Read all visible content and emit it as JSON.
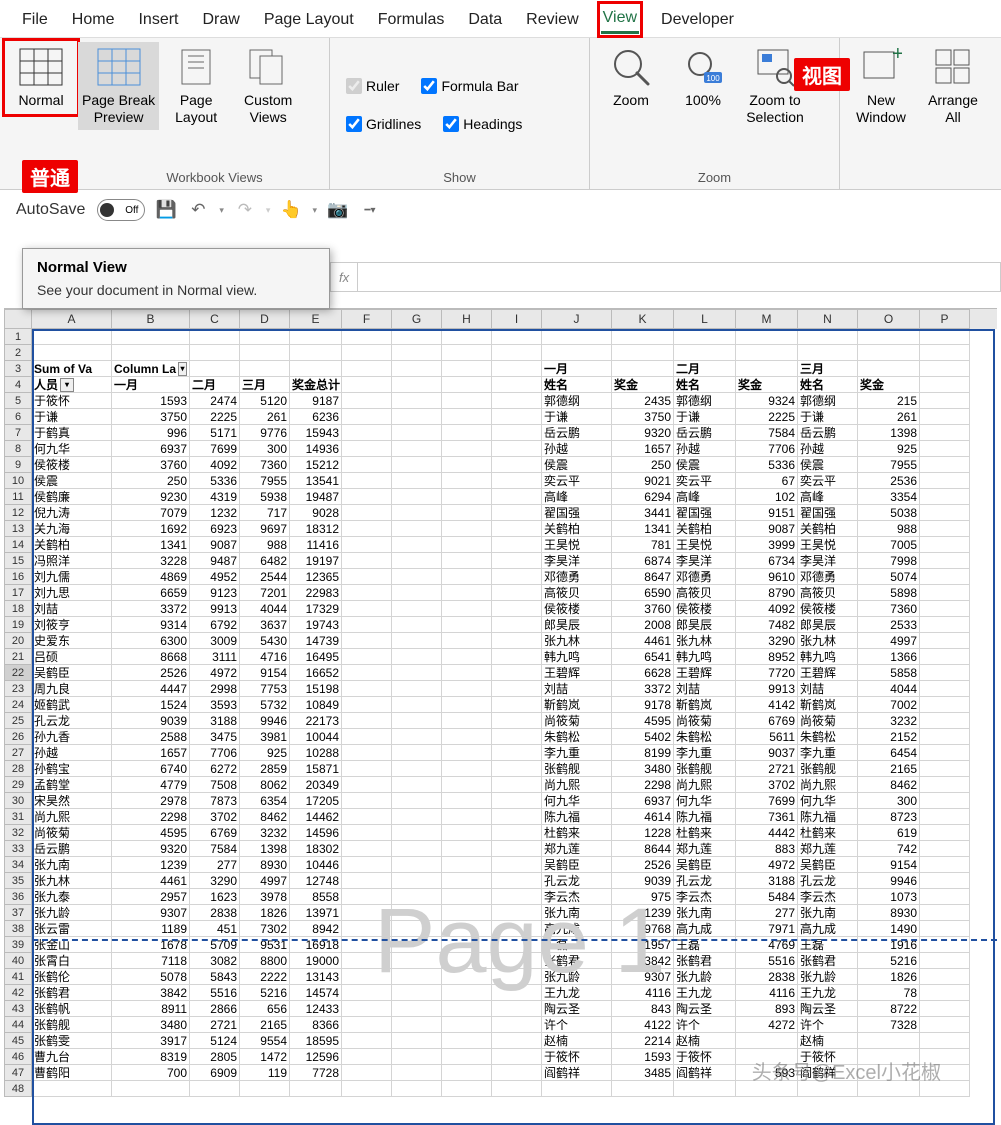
{
  "tabs": [
    "File",
    "Home",
    "Insert",
    "Draw",
    "Page Layout",
    "Formulas",
    "Data",
    "Review",
    "View",
    "Developer"
  ],
  "active_tab": "View",
  "ribbon": {
    "workbook_views": {
      "label": "Workbook Views",
      "buttons": [
        "Normal",
        "Page Break\nPreview",
        "Page\nLayout",
        "Custom\nViews"
      ]
    },
    "show": {
      "label": "Show",
      "checks": [
        {
          "label": "Ruler",
          "checked": true,
          "disabled": true
        },
        {
          "label": "Formula Bar",
          "checked": true
        },
        {
          "label": "Gridlines",
          "checked": true
        },
        {
          "label": "Headings",
          "checked": true
        }
      ]
    },
    "zoom": {
      "label": "Zoom",
      "buttons": [
        "Zoom",
        "100%",
        "Zoom to\nSelection"
      ]
    },
    "window": {
      "buttons": [
        "New\nWindow",
        "Arrange\nAll"
      ]
    }
  },
  "qat": {
    "autosave": "AutoSave",
    "autosave_state": "Off"
  },
  "tooltip": {
    "title": "Normal View",
    "body": "See your document in Normal view."
  },
  "annotations": {
    "normal_cn": "普通",
    "view_cn": "视图"
  },
  "watermark": "Page 1",
  "author_watermark": "头条号@Excel小花椒",
  "cols": {
    "A": 80,
    "B": 78,
    "C": 50,
    "D": 50,
    "E": 52,
    "F": 50,
    "G": 50,
    "H": 50,
    "I": 50,
    "J": 70,
    "K": 62,
    "L": 62,
    "M": 62,
    "N": 60,
    "O": 62,
    "P": 50
  },
  "row3": {
    "A": "Sum of Va",
    "B": "Column La",
    "J": "一月",
    "L": "二月",
    "N": "三月"
  },
  "row4": {
    "A": "人员",
    "B": "一月",
    "C": "二月",
    "D": "三月",
    "E": "奖金总计",
    "J": "姓名",
    "K": "奖金",
    "L": "姓名",
    "M": "奖金",
    "N": "姓名",
    "O": "奖金"
  },
  "data": [
    {
      "n": 5,
      "A": "于筱怀",
      "B": 1593,
      "C": 2474,
      "D": 5120,
      "E": 9187,
      "J": "郭德纲",
      "K": 2435,
      "L": "郭德纲",
      "M": 9324,
      "N": "郭德纲",
      "O": 215
    },
    {
      "n": 6,
      "A": "于谦",
      "B": 3750,
      "C": 2225,
      "D": 261,
      "E": 6236,
      "J": "于谦",
      "K": 3750,
      "L": "于谦",
      "M": 2225,
      "N": "于谦",
      "O": 261
    },
    {
      "n": 7,
      "A": "于鹤真",
      "B": 996,
      "C": 5171,
      "D": 9776,
      "E": 15943,
      "J": "岳云鹏",
      "K": 9320,
      "L": "岳云鹏",
      "M": 7584,
      "N": "岳云鹏",
      "O": 1398
    },
    {
      "n": 8,
      "A": "何九华",
      "B": 6937,
      "C": 7699,
      "D": 300,
      "E": 14936,
      "J": "孙越",
      "K": 1657,
      "L": "孙越",
      "M": 7706,
      "N": "孙越",
      "O": 925
    },
    {
      "n": 9,
      "A": "侯筱楼",
      "B": 3760,
      "C": 4092,
      "D": 7360,
      "E": 15212,
      "J": "侯震",
      "K": 250,
      "L": "侯震",
      "M": 5336,
      "N": "侯震",
      "O": 7955
    },
    {
      "n": 10,
      "A": "侯震",
      "B": 250,
      "C": 5336,
      "D": 7955,
      "E": 13541,
      "J": "奕云平",
      "K": 9021,
      "L": "奕云平",
      "M": 67,
      "N": "奕云平",
      "O": 2536
    },
    {
      "n": 11,
      "A": "侯鹤廉",
      "B": 9230,
      "C": 4319,
      "D": 5938,
      "E": 19487,
      "J": "高峰",
      "K": 6294,
      "L": "高峰",
      "M": 102,
      "N": "高峰",
      "O": 3354
    },
    {
      "n": 12,
      "A": "倪九涛",
      "B": 7079,
      "C": 1232,
      "D": 717,
      "E": 9028,
      "J": "翟国强",
      "K": 3441,
      "L": "翟国强",
      "M": 9151,
      "N": "翟国强",
      "O": 5038
    },
    {
      "n": 13,
      "A": "关九海",
      "B": 1692,
      "C": 6923,
      "D": 9697,
      "E": 18312,
      "J": "关鹤柏",
      "K": 1341,
      "L": "关鹤柏",
      "M": 9087,
      "N": "关鹤柏",
      "O": 988
    },
    {
      "n": 14,
      "A": "关鹤柏",
      "B": 1341,
      "C": 9087,
      "D": 988,
      "E": 11416,
      "J": "王昊悦",
      "K": 781,
      "L": "王昊悦",
      "M": 3999,
      "N": "王昊悦",
      "O": 7005
    },
    {
      "n": 15,
      "A": "冯照洋",
      "B": 3228,
      "C": 9487,
      "D": 6482,
      "E": 19197,
      "J": "李昊洋",
      "K": 6874,
      "L": "李昊洋",
      "M": 6734,
      "N": "李昊洋",
      "O": 7998
    },
    {
      "n": 16,
      "A": "刘九儒",
      "B": 4869,
      "C": 4952,
      "D": 2544,
      "E": 12365,
      "J": "邓德勇",
      "K": 8647,
      "L": "邓德勇",
      "M": 9610,
      "N": "邓德勇",
      "O": 5074
    },
    {
      "n": 17,
      "A": "刘九思",
      "B": 6659,
      "C": 9123,
      "D": 7201,
      "E": 22983,
      "J": "高筱贝",
      "K": 6590,
      "L": "高筱贝",
      "M": 8790,
      "N": "高筱贝",
      "O": 5898
    },
    {
      "n": 18,
      "A": "刘喆",
      "B": 3372,
      "C": 9913,
      "D": 4044,
      "E": 17329,
      "J": "侯筱楼",
      "K": 3760,
      "L": "侯筱楼",
      "M": 4092,
      "N": "侯筱楼",
      "O": 7360
    },
    {
      "n": 19,
      "A": "刘筱亨",
      "B": 9314,
      "C": 6792,
      "D": 3637,
      "E": 19743,
      "J": "郎昊辰",
      "K": 2008,
      "L": "郎昊辰",
      "M": 7482,
      "N": "郎昊辰",
      "O": 2533
    },
    {
      "n": 20,
      "A": "史爱东",
      "B": 6300,
      "C": 3009,
      "D": 5430,
      "E": 14739,
      "J": "张九林",
      "K": 4461,
      "L": "张九林",
      "M": 3290,
      "N": "张九林",
      "O": 4997
    },
    {
      "n": 21,
      "A": "吕硕",
      "B": 8668,
      "C": 3111,
      "D": 4716,
      "E": 16495,
      "J": "韩九鸣",
      "K": 6541,
      "L": "韩九鸣",
      "M": 8952,
      "N": "韩九鸣",
      "O": 1366
    },
    {
      "n": 22,
      "A": "吴鹤臣",
      "B": 2526,
      "C": 4972,
      "D": 9154,
      "E": 16652,
      "J": "王碧辉",
      "K": 6628,
      "L": "王碧辉",
      "M": 7720,
      "N": "王碧辉",
      "O": 5858
    },
    {
      "n": 23,
      "A": "周九良",
      "B": 4447,
      "C": 2998,
      "D": 7753,
      "E": 15198,
      "J": "刘喆",
      "K": 3372,
      "L": "刘喆",
      "M": 9913,
      "N": "刘喆",
      "O": 4044
    },
    {
      "n": 24,
      "A": "姬鹤武",
      "B": 1524,
      "C": 3593,
      "D": 5732,
      "E": 10849,
      "J": "靳鹤岚",
      "K": 9178,
      "L": "靳鹤岚",
      "M": 4142,
      "N": "靳鹤岚",
      "O": 7002
    },
    {
      "n": 25,
      "A": "孔云龙",
      "B": 9039,
      "C": 3188,
      "D": 9946,
      "E": 22173,
      "J": "尚筱菊",
      "K": 4595,
      "L": "尚筱菊",
      "M": 6769,
      "N": "尚筱菊",
      "O": 3232
    },
    {
      "n": 26,
      "A": "孙九香",
      "B": 2588,
      "C": 3475,
      "D": 3981,
      "E": 10044,
      "J": "朱鹤松",
      "K": 5402,
      "L": "朱鹤松",
      "M": 5611,
      "N": "朱鹤松",
      "O": 2152
    },
    {
      "n": 27,
      "A": "孙越",
      "B": 1657,
      "C": 7706,
      "D": 925,
      "E": 10288,
      "J": "李九重",
      "K": 8199,
      "L": "李九重",
      "M": 9037,
      "N": "李九重",
      "O": 6454
    },
    {
      "n": 28,
      "A": "孙鹤宝",
      "B": 6740,
      "C": 6272,
      "D": 2859,
      "E": 15871,
      "J": "张鹤舰",
      "K": 3480,
      "L": "张鹤舰",
      "M": 2721,
      "N": "张鹤舰",
      "O": 2165
    },
    {
      "n": 29,
      "A": "孟鹤堂",
      "B": 4779,
      "C": 7508,
      "D": 8062,
      "E": 20349,
      "J": "尚九熙",
      "K": 2298,
      "L": "尚九熙",
      "M": 3702,
      "N": "尚九熙",
      "O": 8462
    },
    {
      "n": 30,
      "A": "宋昊然",
      "B": 2978,
      "C": 7873,
      "D": 6354,
      "E": 17205,
      "J": "何九华",
      "K": 6937,
      "L": "何九华",
      "M": 7699,
      "N": "何九华",
      "O": 300
    },
    {
      "n": 31,
      "A": "尚九熙",
      "B": 2298,
      "C": 3702,
      "D": 8462,
      "E": 14462,
      "J": "陈九福",
      "K": 4614,
      "L": "陈九福",
      "M": 7361,
      "N": "陈九福",
      "O": 8723
    },
    {
      "n": 32,
      "A": "尚筱菊",
      "B": 4595,
      "C": 6769,
      "D": 3232,
      "E": 14596,
      "J": "杜鹤来",
      "K": 1228,
      "L": "杜鹤来",
      "M": 4442,
      "N": "杜鹤来",
      "O": 619
    },
    {
      "n": 33,
      "A": "岳云鹏",
      "B": 9320,
      "C": 7584,
      "D": 1398,
      "E": 18302,
      "J": "郑九莲",
      "K": 8644,
      "L": "郑九莲",
      "M": 883,
      "N": "郑九莲",
      "O": 742
    },
    {
      "n": 34,
      "A": "张九南",
      "B": 1239,
      "C": 277,
      "D": 8930,
      "E": 10446,
      "J": "吴鹤臣",
      "K": 2526,
      "L": "吴鹤臣",
      "M": 4972,
      "N": "吴鹤臣",
      "O": 9154
    },
    {
      "n": 35,
      "A": "张九林",
      "B": 4461,
      "C": 3290,
      "D": 4997,
      "E": 12748,
      "J": "孔云龙",
      "K": 9039,
      "L": "孔云龙",
      "M": 3188,
      "N": "孔云龙",
      "O": 9946
    },
    {
      "n": 36,
      "A": "张九泰",
      "B": 2957,
      "C": 1623,
      "D": 3978,
      "E": 8558,
      "J": "李云杰",
      "K": 975,
      "L": "李云杰",
      "M": 5484,
      "N": "李云杰",
      "O": 1073
    },
    {
      "n": 37,
      "A": "张九龄",
      "B": 9307,
      "C": 2838,
      "D": 1826,
      "E": 13971,
      "J": "张九南",
      "K": 1239,
      "L": "张九南",
      "M": 277,
      "N": "张九南",
      "O": 8930
    },
    {
      "n": 38,
      "A": "张云雷",
      "B": 1189,
      "C": 451,
      "D": 7302,
      "E": 8942,
      "J": "高九成",
      "K": 9768,
      "L": "高九成",
      "M": 7971,
      "N": "高九成",
      "O": 1490
    },
    {
      "n": 39,
      "A": "张金山",
      "B": 1678,
      "C": 5709,
      "D": 9531,
      "E": 16918,
      "J": "王磊",
      "K": 1957,
      "L": "王磊",
      "M": 4769,
      "N": "王磊",
      "O": 1916
    },
    {
      "n": 40,
      "A": "张霄白",
      "B": 7118,
      "C": 3082,
      "D": 8800,
      "E": 19000,
      "J": "张鹤君",
      "K": 3842,
      "L": "张鹤君",
      "M": 5516,
      "N": "张鹤君",
      "O": 5216
    },
    {
      "n": 41,
      "A": "张鹤伦",
      "B": 5078,
      "C": 5843,
      "D": 2222,
      "E": 13143,
      "J": "张九龄",
      "K": 9307,
      "L": "张九龄",
      "M": 2838,
      "N": "张九龄",
      "O": 1826
    },
    {
      "n": 42,
      "A": "张鹤君",
      "B": 3842,
      "C": 5516,
      "D": 5216,
      "E": 14574,
      "J": "王九龙",
      "K": 4116,
      "L": "王九龙",
      "M": 4116,
      "N": "王九龙",
      "O": 78
    },
    {
      "n": 43,
      "A": "张鹤帆",
      "B": 8911,
      "C": 2866,
      "D": 656,
      "E": 12433,
      "J": "陶云圣",
      "K": 843,
      "L": "陶云圣",
      "M": 893,
      "N": "陶云圣",
      "O": 8722
    },
    {
      "n": 44,
      "A": "张鹤舰",
      "B": 3480,
      "C": 2721,
      "D": 2165,
      "E": 8366,
      "J": "许个",
      "K": 4122,
      "L": "许个",
      "M": 4272,
      "N": "许个",
      "O": 7328
    },
    {
      "n": 45,
      "A": "张鹤雯",
      "B": 3917,
      "C": 5124,
      "D": 9554,
      "E": 18595,
      "J": "赵楠",
      "K": 2214,
      "L": "赵楠",
      "M": "",
      "N": "赵楠",
      "O": ""
    },
    {
      "n": 46,
      "A": "曹九台",
      "B": 8319,
      "C": 2805,
      "D": 1472,
      "E": 12596,
      "J": "于筱怀",
      "K": 1593,
      "L": "于筱怀",
      "M": "",
      "N": "于筱怀",
      "O": ""
    },
    {
      "n": 47,
      "A": "曹鹤阳",
      "B": 700,
      "C": 6909,
      "D": 119,
      "E": 7728,
      "J": "阎鹤祥",
      "K": 3485,
      "L": "阎鹤祥",
      "M": 593,
      "N": "阎鹤祥",
      "O": ""
    }
  ]
}
